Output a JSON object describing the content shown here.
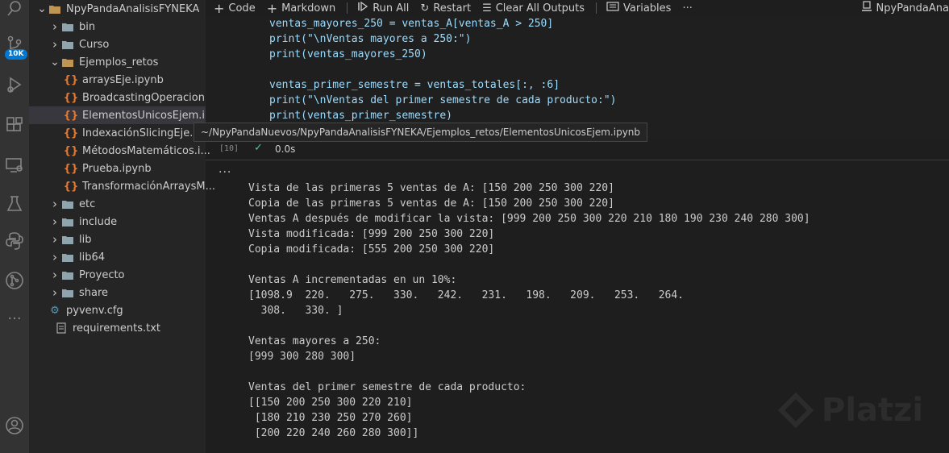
{
  "activity_bar": {
    "icons": [
      "search-icon",
      "source-control-icon",
      "run-debug-icon",
      "extensions-icon",
      "remote-explorer-icon",
      "testing-icon",
      "python-icon",
      "git-graph-icon",
      "more-icon",
      "account-icon"
    ],
    "badge": "10K"
  },
  "explorer": {
    "items": [
      {
        "label": "NpyPandaAnalisisFYNEKA",
        "type": "folder-open",
        "depth": 0
      },
      {
        "label": "bin",
        "type": "folder",
        "depth": 1
      },
      {
        "label": "Curso",
        "type": "folder",
        "depth": 1
      },
      {
        "label": "Ejemplos_retos",
        "type": "folder-open",
        "depth": 1
      },
      {
        "label": "arraysEje.ipynb",
        "type": "notebook",
        "depth": 2
      },
      {
        "label": "BroadcastingOperacion...",
        "type": "notebook",
        "depth": 2
      },
      {
        "label": "ElementosUnicosEjem.i...",
        "type": "notebook",
        "depth": 2,
        "selected": true
      },
      {
        "label": "IndexaciónSlicingEje.ipy",
        "type": "notebook",
        "depth": 2
      },
      {
        "label": "MétodosMatemáticos.i...",
        "type": "notebook",
        "depth": 2
      },
      {
        "label": "Prueba.ipynb",
        "type": "notebook",
        "depth": 2
      },
      {
        "label": "TransformaciónArraysM...",
        "type": "notebook",
        "depth": 2
      },
      {
        "label": "etc",
        "type": "folder",
        "depth": 1
      },
      {
        "label": "include",
        "type": "folder",
        "depth": 1
      },
      {
        "label": "lib",
        "type": "folder",
        "depth": 1
      },
      {
        "label": "lib64",
        "type": "folder",
        "depth": 1
      },
      {
        "label": "Proyecto",
        "type": "folder",
        "depth": 1
      },
      {
        "label": "share",
        "type": "folder",
        "depth": 1
      },
      {
        "label": "pyvenv.cfg",
        "type": "config",
        "depth": 1
      },
      {
        "label": "requirements.txt",
        "type": "text",
        "depth": 0
      }
    ]
  },
  "toolbar": {
    "code_label": "Code",
    "markdown_label": "Markdown",
    "run_all_label": "Run All",
    "restart_label": "Restart",
    "clear_label": "Clear All Outputs",
    "variables_label": "Variables",
    "more_label": "···",
    "kernel_label": "NpyPandaAna"
  },
  "code_lines": [
    "ventas_mayores_250 = ventas_A[ventas_A > 250]",
    "print(\"\\nVentas mayores a 250:\")",
    "print(ventas_mayores_250)",
    "",
    "ventas_primer_semestre = ventas_totales[:, :6]",
    "print(\"\\nVentas del primer semestre de cada producto:\")",
    "print(ventas_primer_semestre)"
  ],
  "tooltip": "~/NpyPandaNuevos/NpyPandaAnalisisFYNEKA/Ejemplos_retos/ElementosUnicosEjem.ipynb",
  "cell_status": {
    "exec_count": "[10]",
    "duration": "0.0s"
  },
  "output_more": "...",
  "output_lines": [
    "Vista de las primeras 5 ventas de A: [150 200 250 300 220]",
    "Copia de las primeras 5 ventas de A: [150 200 250 300 220]",
    "Ventas A después de modificar la vista: [999 200 250 300 220 210 180 190 230 240 280 300]",
    "Vista modificada: [999 200 250 300 220]",
    "Copia modificada: [555 200 250 300 220]",
    "",
    "Ventas A incrementadas en un 10%:",
    "[1098.9  220.   275.   330.   242.   231.   198.   209.   253.   264.",
    "  308.   330. ]",
    "",
    "Ventas mayores a 250:",
    "[999 300 280 300]",
    "",
    "Ventas del primer semestre de cada producto:",
    "[[150 200 250 300 220 210]",
    " [180 210 230 250 270 260]",
    " [200 220 240 260 280 300]]"
  ],
  "watermark": "Platzi"
}
